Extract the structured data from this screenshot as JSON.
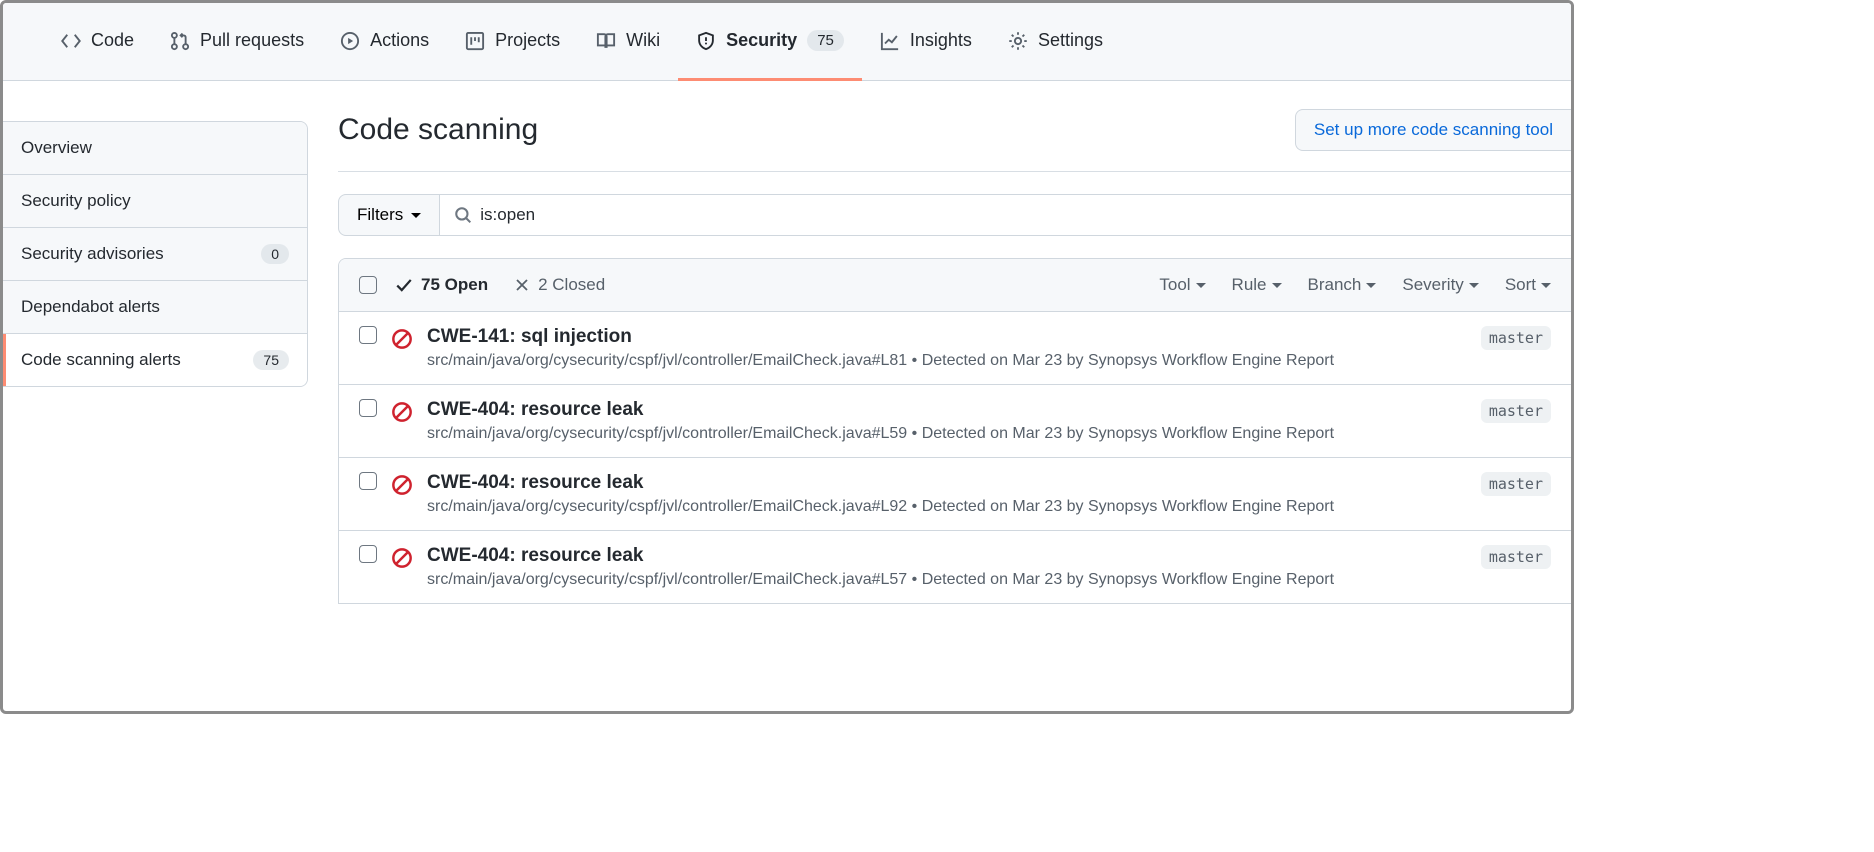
{
  "nav": {
    "items": [
      {
        "label": "Code",
        "icon": "code"
      },
      {
        "label": "Pull requests",
        "icon": "git-pull-request"
      },
      {
        "label": "Actions",
        "icon": "play"
      },
      {
        "label": "Projects",
        "icon": "project"
      },
      {
        "label": "Wiki",
        "icon": "book"
      },
      {
        "label": "Security",
        "icon": "shield",
        "count": "75",
        "active": true
      },
      {
        "label": "Insights",
        "icon": "graph"
      },
      {
        "label": "Settings",
        "icon": "gear"
      }
    ]
  },
  "sidebar": {
    "items": [
      {
        "label": "Overview"
      },
      {
        "label": "Security policy"
      },
      {
        "label": "Security advisories",
        "count": "0"
      },
      {
        "label": "Dependabot alerts"
      },
      {
        "label": "Code scanning alerts",
        "count": "75",
        "active": true
      }
    ]
  },
  "main": {
    "title": "Code scanning",
    "setup_button": "Set up more code scanning tool",
    "filters_label": "Filters",
    "search_value": "is:open",
    "open_label": "75 Open",
    "closed_label": "2 Closed",
    "header_filters": [
      "Tool",
      "Rule",
      "Branch",
      "Severity",
      "Sort"
    ],
    "alerts": [
      {
        "title": "CWE-141: sql injection",
        "path": "src/main/java/org/cysecurity/cspf/jvl/controller/EmailCheck.java#L81",
        "detected": "Detected on Mar 23 by Synopsys Workflow Engine Report",
        "branch": "master"
      },
      {
        "title": "CWE-404: resource leak",
        "path": "src/main/java/org/cysecurity/cspf/jvl/controller/EmailCheck.java#L59",
        "detected": "Detected on Mar 23 by Synopsys Workflow Engine Report",
        "branch": "master"
      },
      {
        "title": "CWE-404: resource leak",
        "path": "src/main/java/org/cysecurity/cspf/jvl/controller/EmailCheck.java#L92",
        "detected": "Detected on Mar 23 by Synopsys Workflow Engine Report",
        "branch": "master"
      },
      {
        "title": "CWE-404: resource leak",
        "path": "src/main/java/org/cysecurity/cspf/jvl/controller/EmailCheck.java#L57",
        "detected": "Detected on Mar 23 by Synopsys Workflow Engine Report",
        "branch": "master"
      }
    ]
  }
}
